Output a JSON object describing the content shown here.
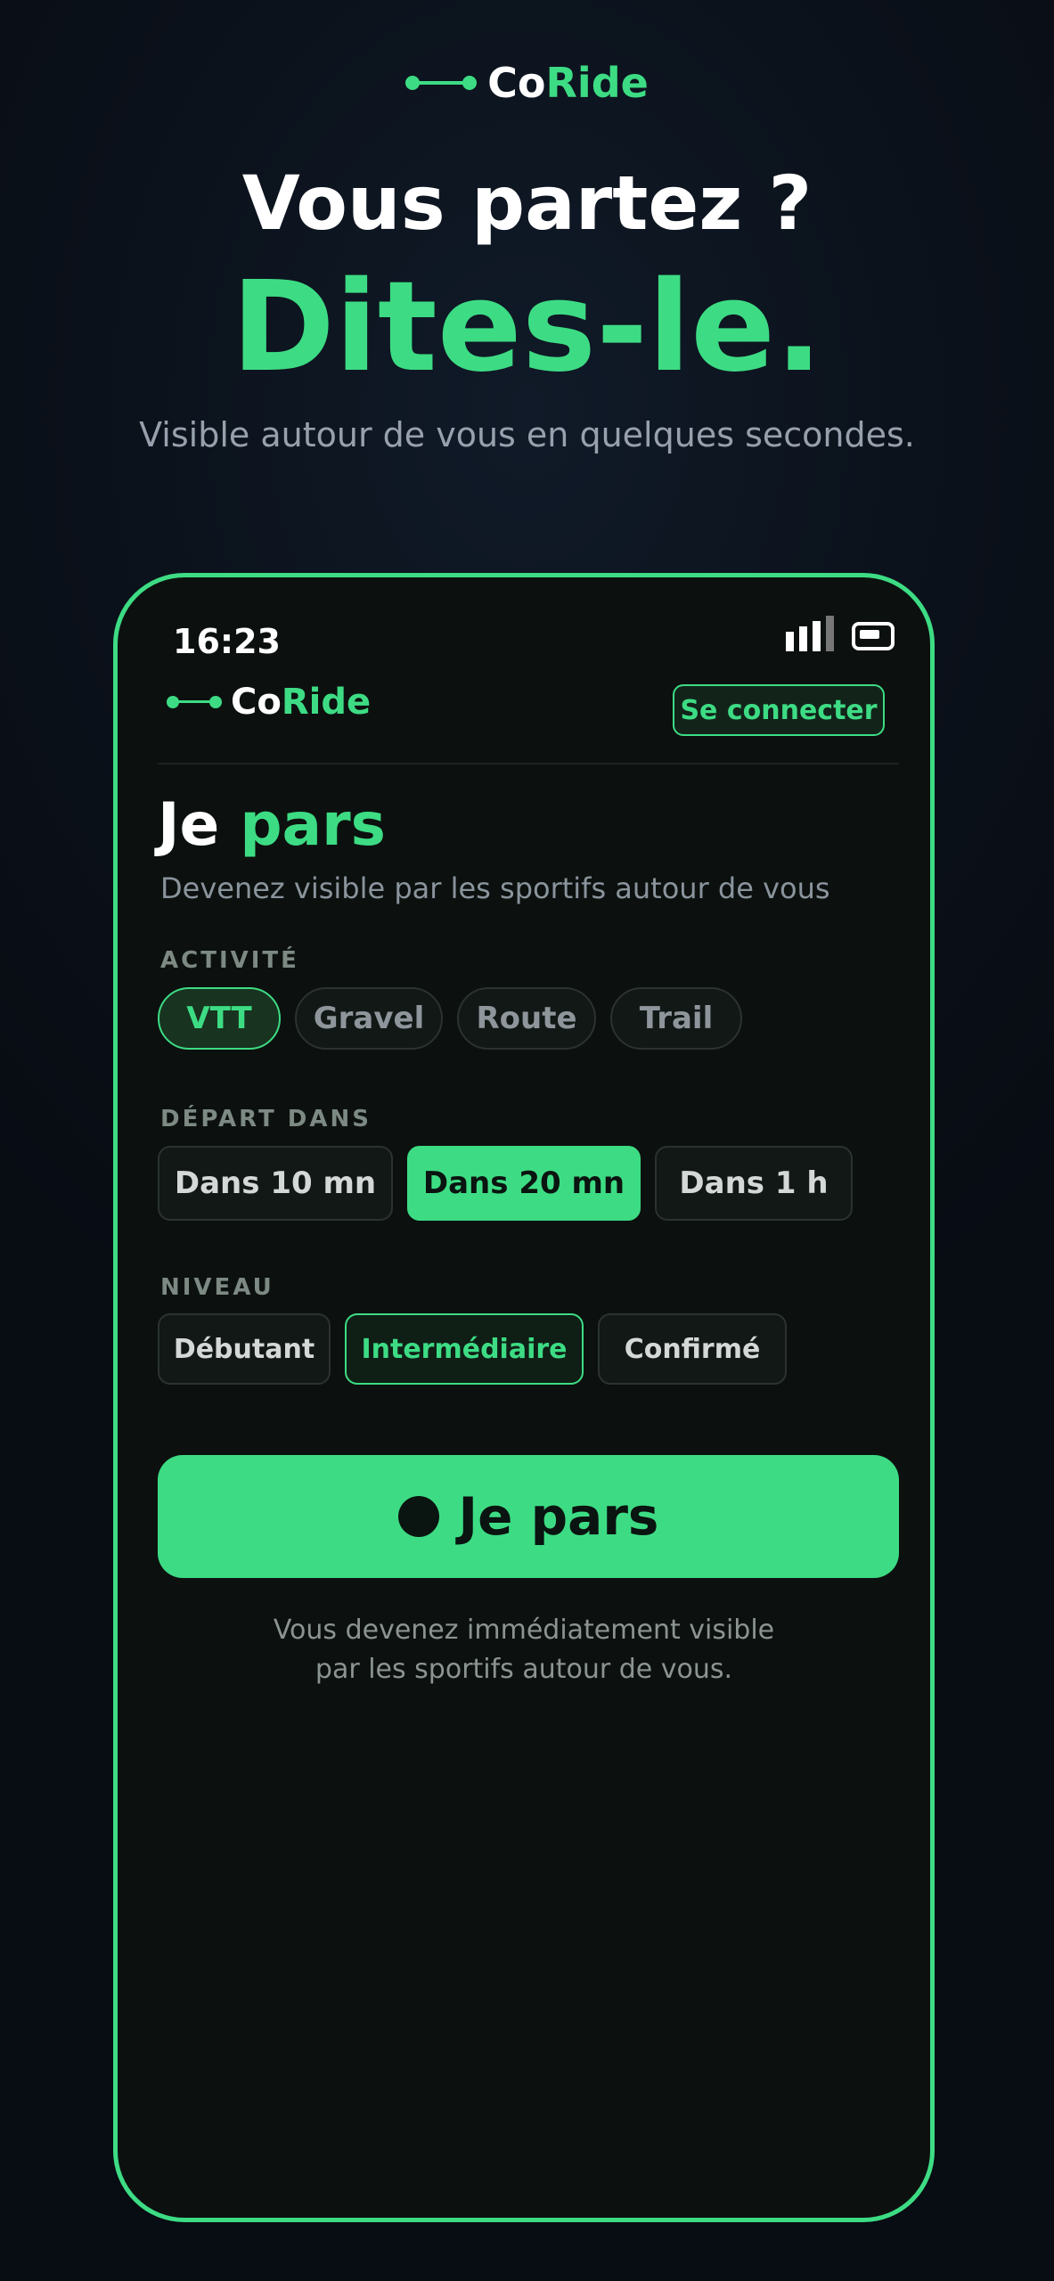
{
  "brand": {
    "name_prefix": "Co",
    "name_suffix": "Ride"
  },
  "hero": {
    "title_line1": "Vous partez ?",
    "title_line2": "Dites-le.",
    "subtitle": "Visible autour de vous en quelques secondes."
  },
  "phone": {
    "status_time": "16:23",
    "header": {
      "connect_label": "Se connecter"
    },
    "page": {
      "title_word1": "Je",
      "title_word2": "pars",
      "subtitle": "Devenez visible par les sportifs autour de vous"
    },
    "activity": {
      "label": "ACTIVITÉ",
      "options": [
        "VTT",
        "Gravel",
        "Route",
        "Trail"
      ],
      "selected": "VTT"
    },
    "departure": {
      "label": "DÉPART DANS",
      "options": [
        "Dans 10 mn",
        "Dans 20 mn",
        "Dans 1 h"
      ],
      "selected": "Dans 20 mn"
    },
    "level": {
      "label": "NIVEAU",
      "options": [
        "Débutant",
        "Intermédiaire",
        "Confirmé"
      ],
      "selected": "Intermédiaire"
    },
    "cta": {
      "label": "Je pars"
    },
    "note_line1": "Vous devenez immédiatement visible",
    "note_line2": "par les sportifs autour de vous."
  },
  "colors": {
    "accent": "#3ddc84",
    "background": "#0b111a",
    "phone_bg": "#0c110f",
    "muted_text": "#97a0ac"
  },
  "icons": {
    "brand_logo": "connected-dots-icon",
    "signal": "signal-bars-icon",
    "battery": "battery-icon",
    "cta_bullet": "record-dot-icon"
  }
}
